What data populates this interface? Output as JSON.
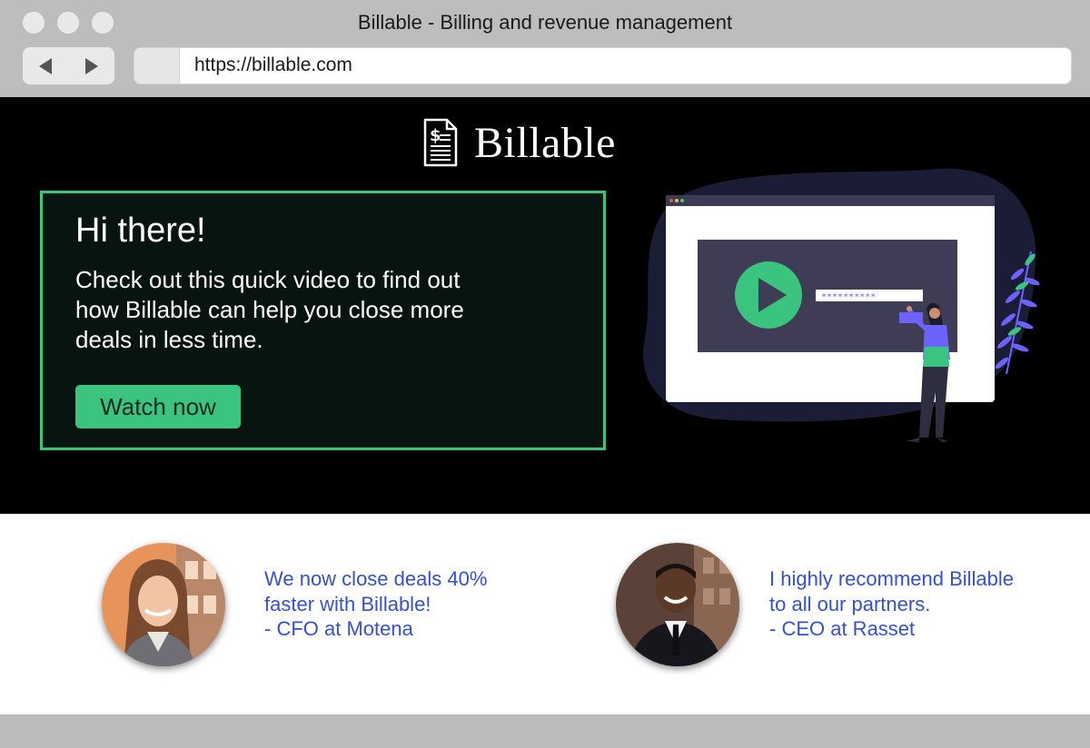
{
  "window": {
    "title": "Billable - Billing and revenue management",
    "url": "https://billable.com"
  },
  "brand": {
    "name": "Billable",
    "logo_icon": "invoice-dollar-icon"
  },
  "hero": {
    "heading": "Hi there!",
    "body_lines": [
      "Check out this quick video to find out",
      "how Billable can help you close more",
      "deals in less time."
    ],
    "cta_label": "Watch now",
    "illustration": {
      "field_text": "**********",
      "play_icon": "play-icon"
    }
  },
  "testimonials": [
    {
      "lines": [
        "We now close deals 40%",
        "faster with Billable!",
        "- CFO at Motena"
      ]
    },
    {
      "lines": [
        "I highly recommend Billable",
        "to all our partners.",
        "- CEO at Rasset"
      ]
    }
  ],
  "colors": {
    "accent": "#3ac47f",
    "quote_text": "#3450d8",
    "hero_bg": "#000000",
    "chrome_bg": "#bdbdbd"
  }
}
